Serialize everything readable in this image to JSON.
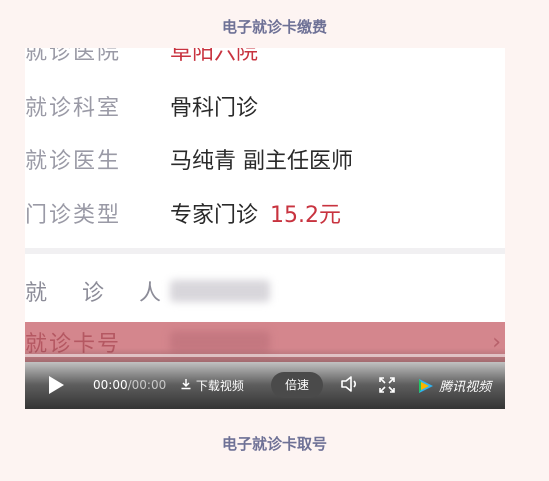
{
  "captions": {
    "top": "电子就诊卡缴费",
    "bottom": "电子就诊卡取号"
  },
  "rows": [
    {
      "label": "就诊医院",
      "value": "阜阳六院"
    },
    {
      "label": "就诊科室",
      "value": "骨科门诊"
    },
    {
      "label": "就诊医生",
      "value": "马纯青 副主任医师"
    },
    {
      "label": "门诊类型",
      "value": "专家门诊",
      "price": "15.2元"
    }
  ],
  "patient": {
    "label": "就 诊 人"
  },
  "card": {
    "label": "就诊卡号",
    "chevron": "›"
  },
  "player": {
    "time_current": "00:00",
    "time_total": "/00:00",
    "download_label": "下载视频",
    "speed_label": "倍速",
    "brand_label": "腾讯视频",
    "progress_fraction": 0
  },
  "colors": {
    "accent_red": "#c8333f",
    "card_bar": "#d4868d",
    "caption": "#6e7196"
  }
}
